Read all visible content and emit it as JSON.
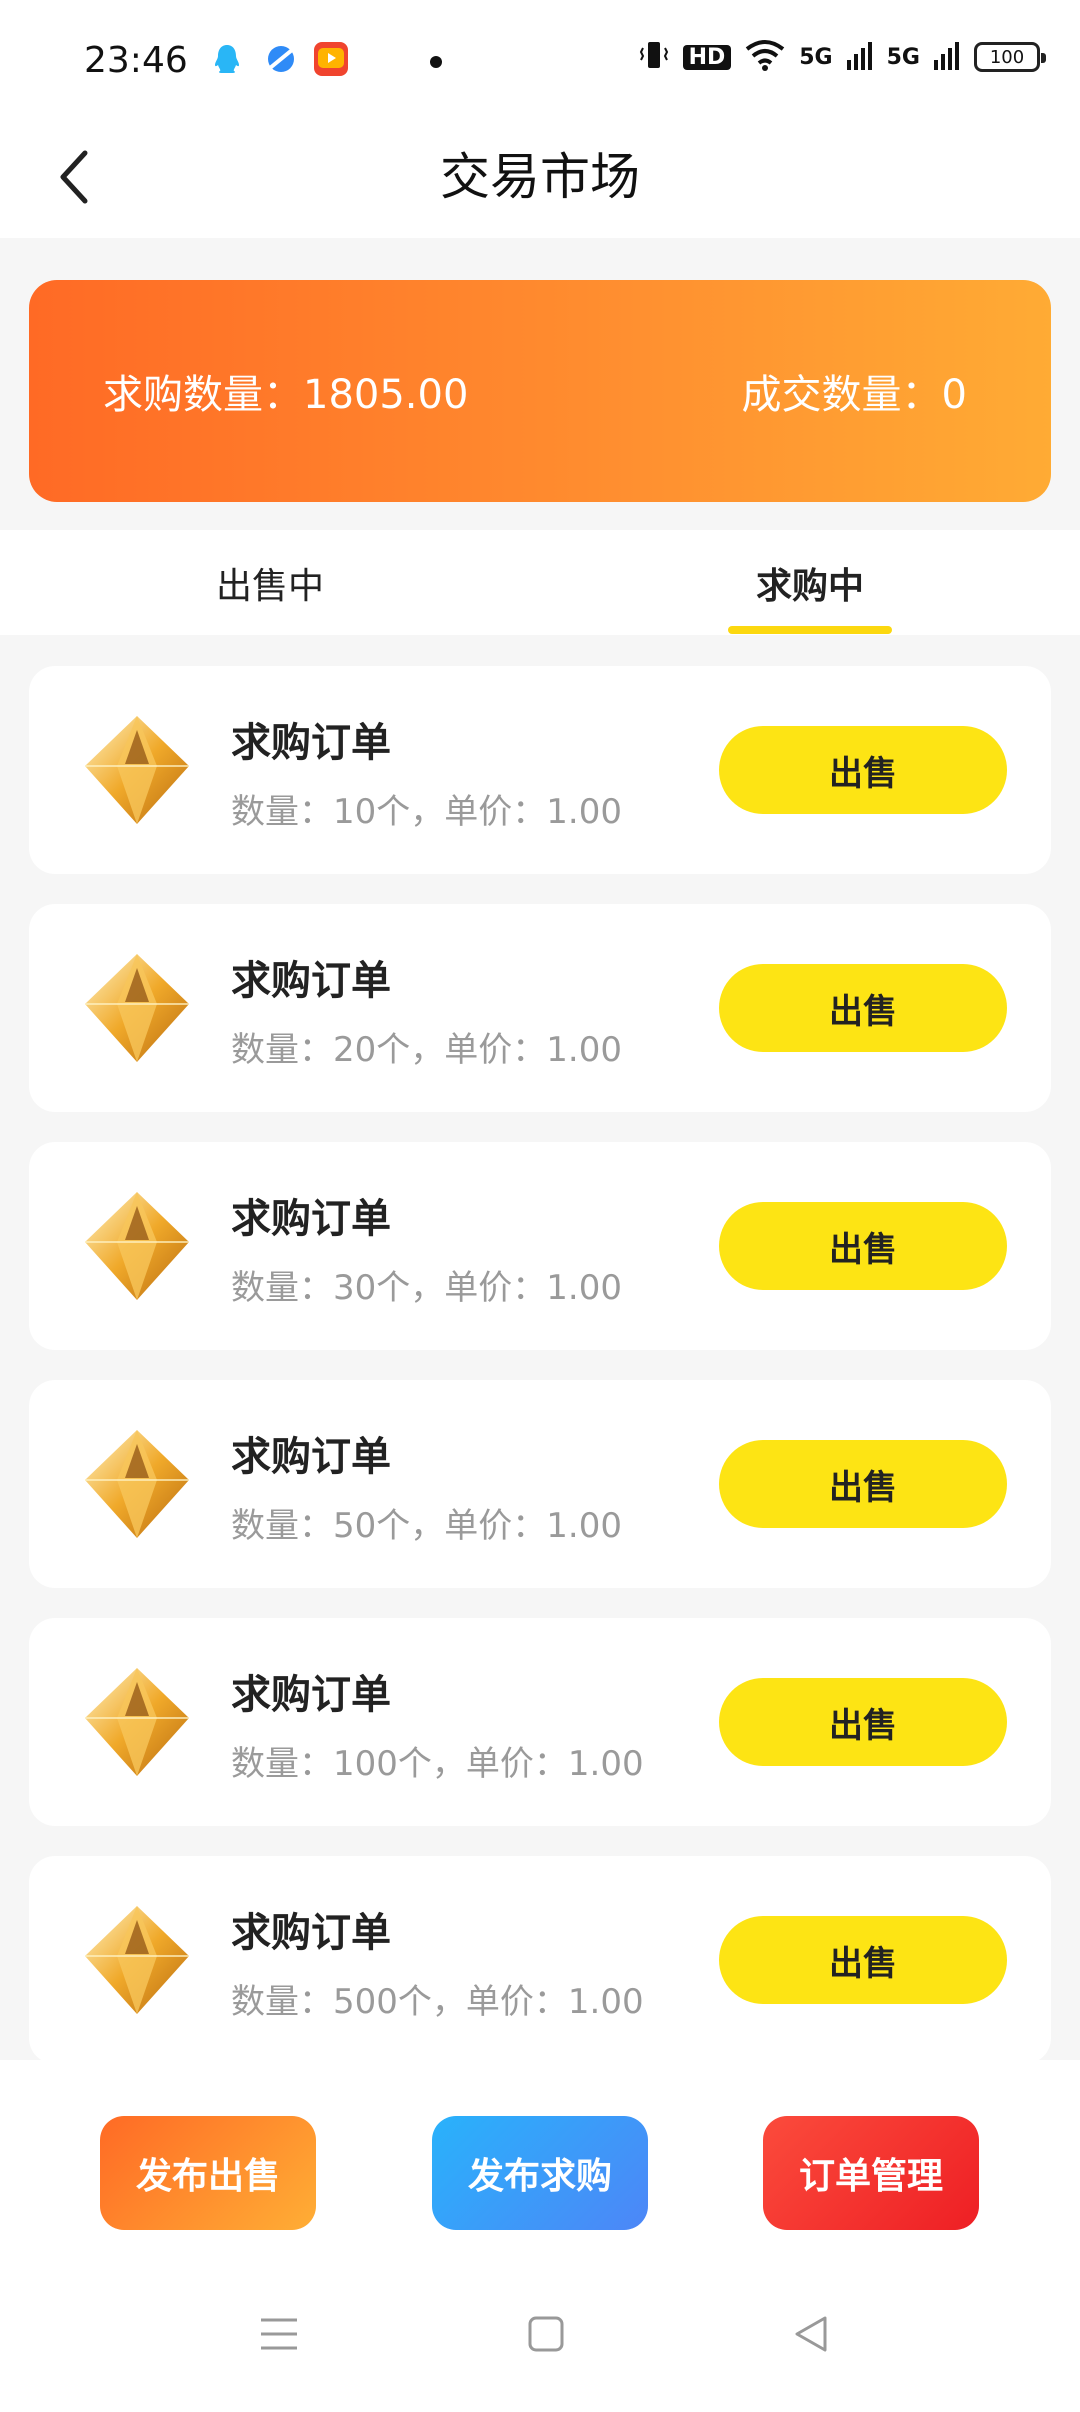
{
  "status_bar": {
    "time": "23:46",
    "hd_label": "HD",
    "network_1": "5G",
    "network_2": "5G",
    "battery": "100",
    "apps": [
      "qq-icon",
      "browser-icon",
      "video-app-icon"
    ]
  },
  "header": {
    "title": "交易市场",
    "back_icon": "chevron-left-icon"
  },
  "stats": {
    "buy_quantity": "求购数量：1805.00",
    "deal_quantity": "成交数量：0"
  },
  "tabs": [
    {
      "label": "出售中",
      "selected": false
    },
    {
      "label": "求购中",
      "selected": true
    }
  ],
  "orders": [
    {
      "title": "求购订单",
      "detail": "数量：10个，单价：1.00",
      "button": "出售"
    },
    {
      "title": "求购订单",
      "detail": "数量：20个，单价：1.00",
      "button": "出售"
    },
    {
      "title": "求购订单",
      "detail": "数量：30个，单价：1.00",
      "button": "出售"
    },
    {
      "title": "求购订单",
      "detail": "数量：50个，单价：1.00",
      "button": "出售"
    },
    {
      "title": "求购订单",
      "detail": "数量：100个，单价：1.00",
      "button": "出售"
    },
    {
      "title": "求购订单",
      "detail": "数量：500个，单价：1.00",
      "button": "出售"
    }
  ],
  "actions": {
    "publish_sell": "发布出售",
    "publish_buy": "发布求购",
    "order_manage": "订单管理"
  },
  "colors": {
    "accent_yellow": "#fde414",
    "banner_start": "#ff6a25",
    "banner_end": "#ffab34",
    "buy_blue": "#29b2fb",
    "orders_red": "#ee1f24"
  }
}
